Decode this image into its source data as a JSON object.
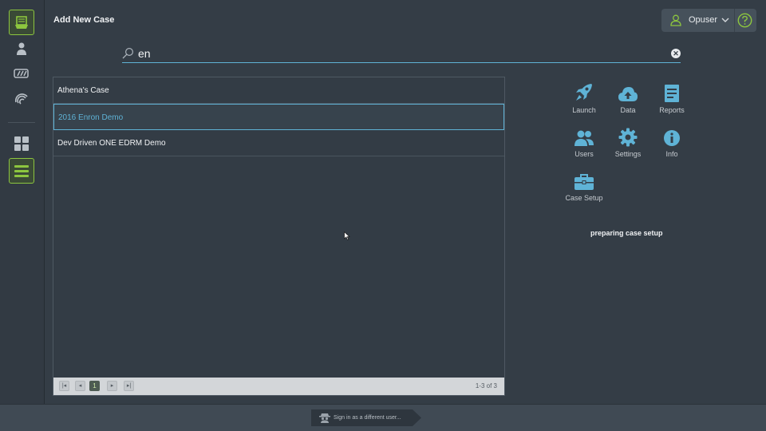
{
  "header": {
    "title": "Add New Case"
  },
  "user": {
    "name": "Opuser"
  },
  "search": {
    "value": "en"
  },
  "cases": [
    {
      "name": "Athena's Case"
    },
    {
      "name": "2016 Enron Demo"
    },
    {
      "name": "Dev Driven ONE EDRM Demo"
    }
  ],
  "pager": {
    "current": "1",
    "count": "1-3 of 3"
  },
  "actions": {
    "launch": "Launch",
    "data": "Data",
    "reports": "Reports",
    "users": "Users",
    "settings": "Settings",
    "info": "Info",
    "case_setup": "Case Setup"
  },
  "status": "preparing case setup",
  "footer": {
    "signin": "Sign in as a different user..."
  },
  "colors": {
    "accent_blue": "#5fb3d6",
    "accent_green": "#8dc63f",
    "background": "#343d46"
  }
}
